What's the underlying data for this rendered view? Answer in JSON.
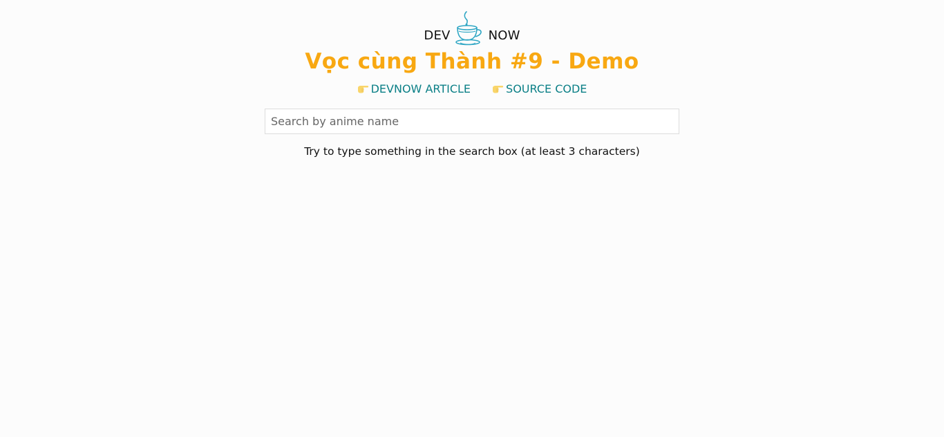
{
  "brand": {
    "left_word": "DEV",
    "right_word": "NOW",
    "logo_icon": "coffee-cup-icon",
    "logo_color": "#2ea6c4"
  },
  "title": "Vọc cùng Thành #9 - Demo",
  "title_color": "#f8a812",
  "links": [
    {
      "label": "DEVNOW ARTICLE",
      "icon": "pointing-hand-icon"
    },
    {
      "label": "SOURCE CODE",
      "icon": "pointing-hand-icon"
    }
  ],
  "link_color": "#0a7f86",
  "search": {
    "value": "",
    "placeholder": "Search by anime name"
  },
  "hint": "Try to type something in the search box (at least 3 characters)"
}
